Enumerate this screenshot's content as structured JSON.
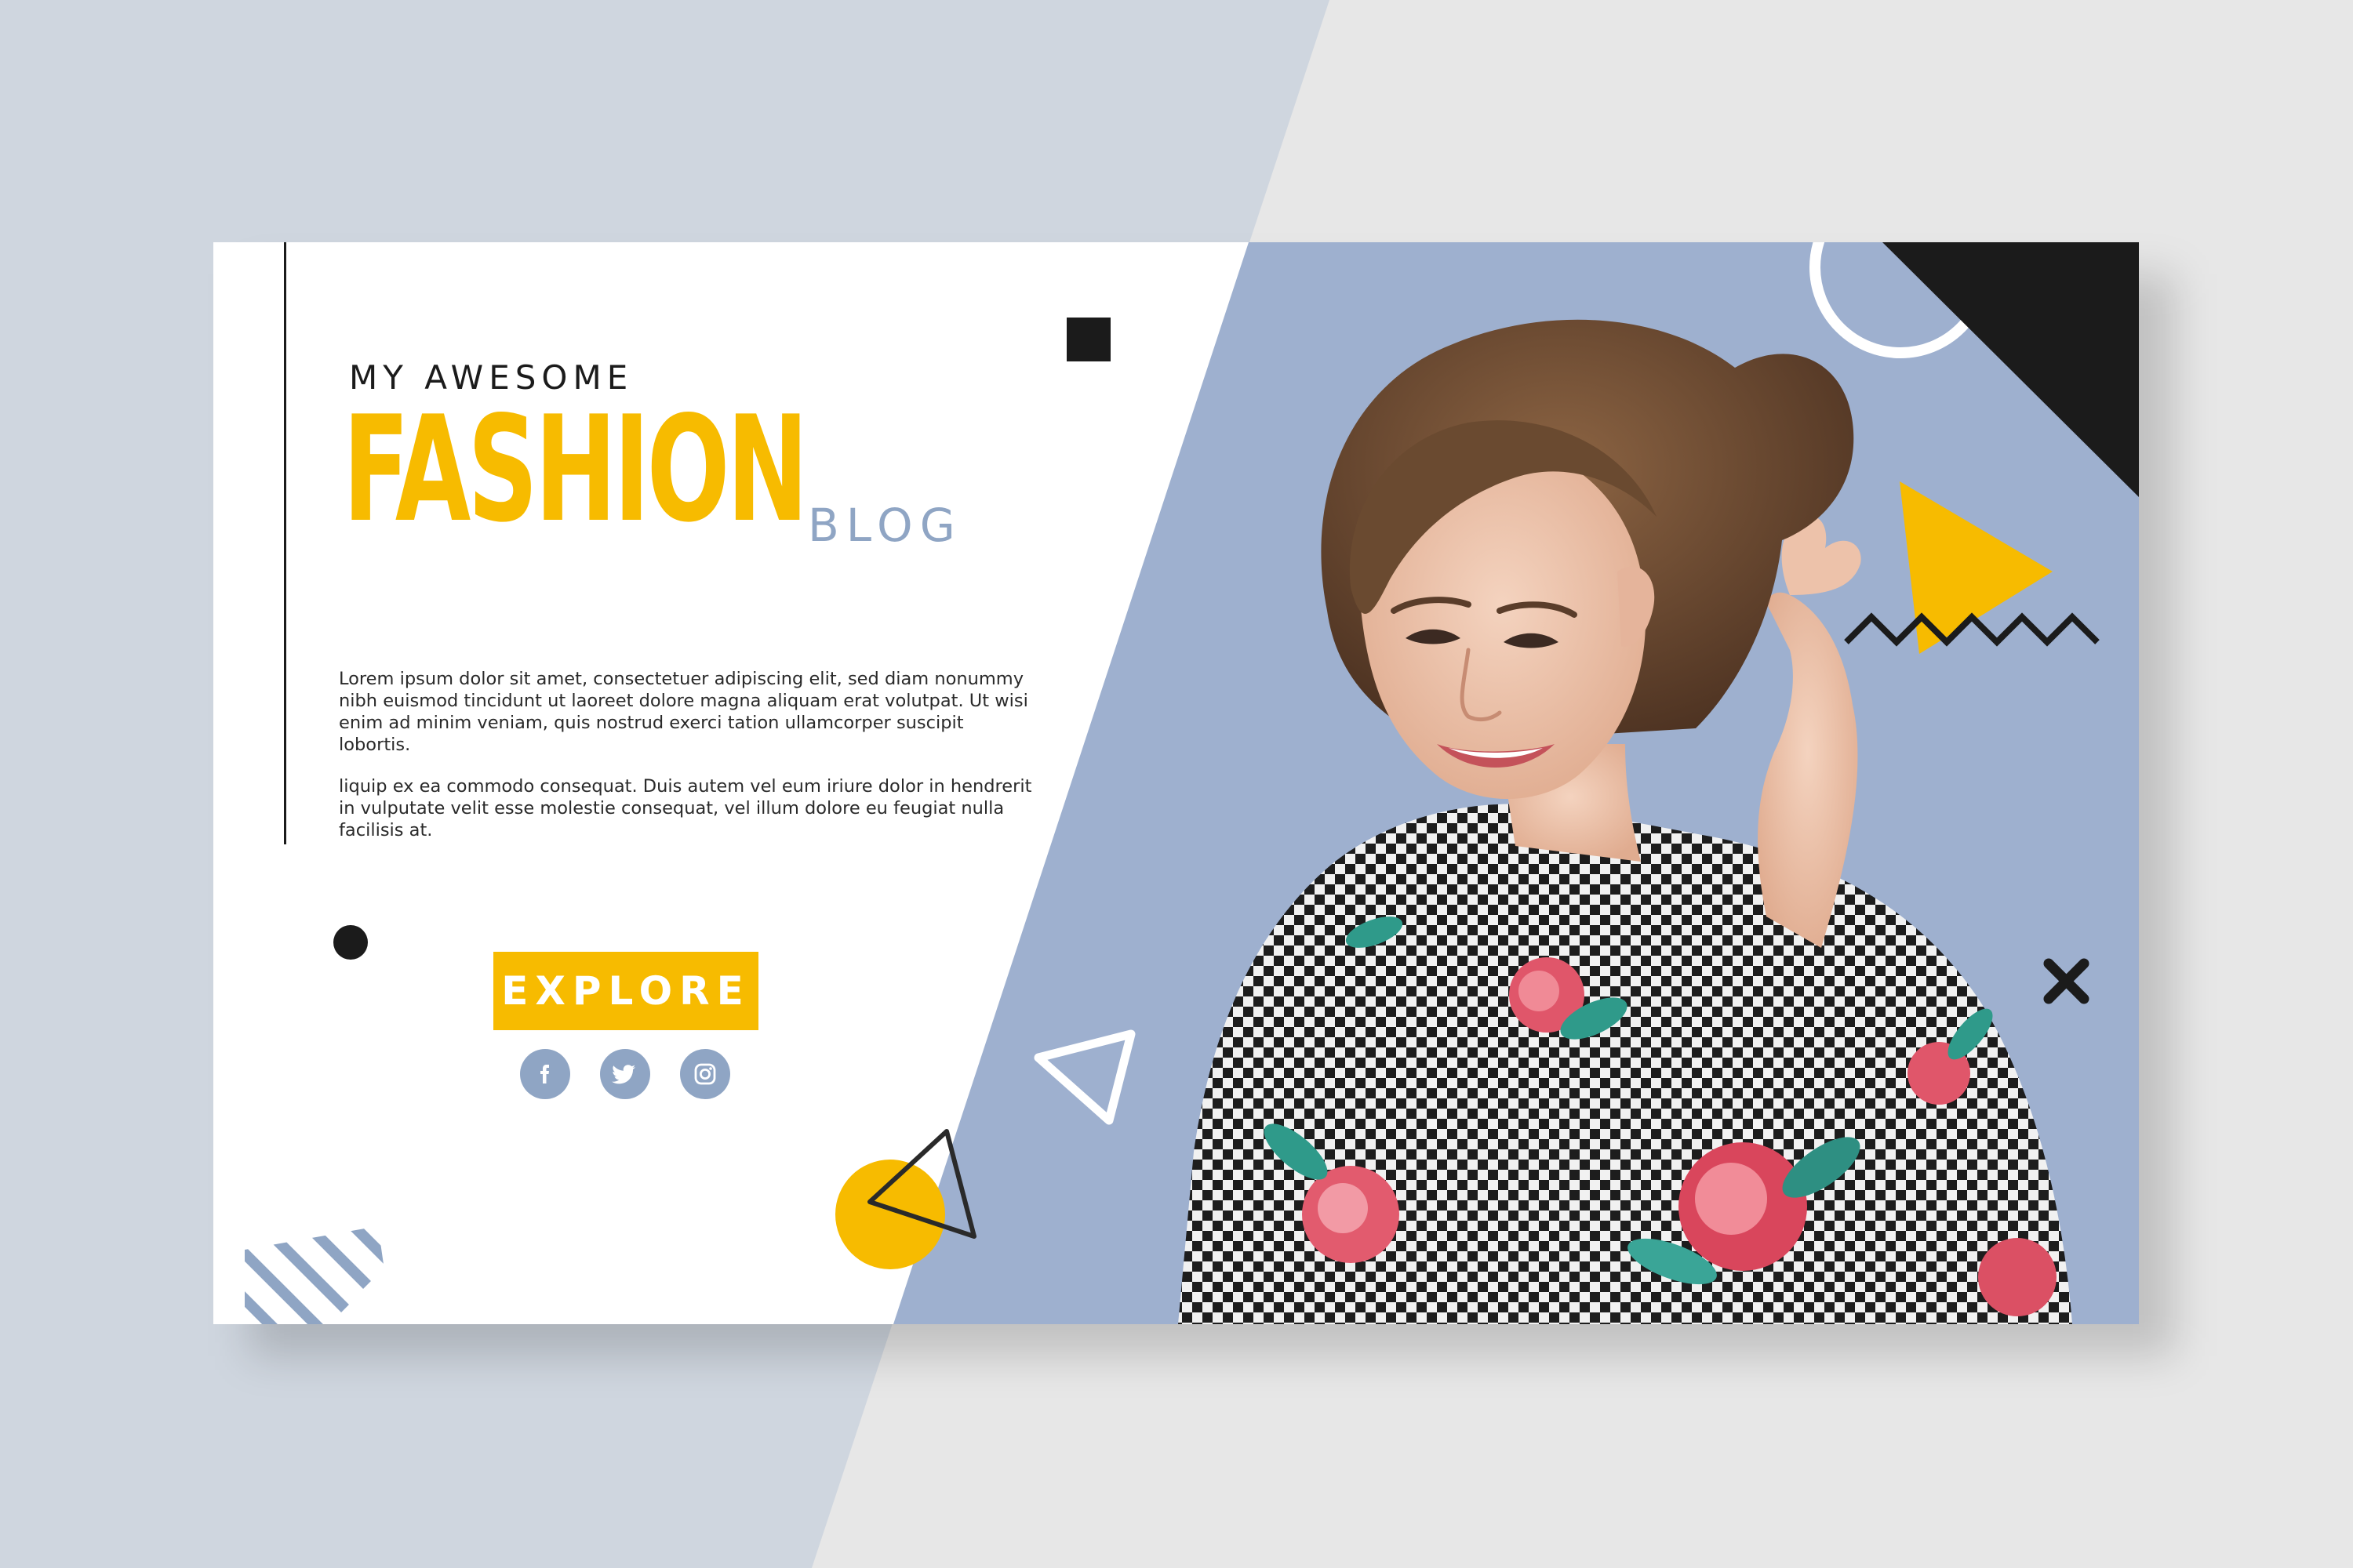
{
  "banner": {
    "kicker": "MY AWESOME",
    "title": "FASHION",
    "subtitle": "BLOG",
    "paragraph_1": "Lorem ipsum dolor sit amet, consectetuer adipiscing elit, sed diam nonummy nibh euismod tincidunt ut laoreet dolore magna aliquam erat volutpat. Ut wisi enim ad minim veniam, quis nostrud exerci tation ullamcorper suscipit lobortis.",
    "paragraph_2": "liquip ex ea commodo consequat. Duis autem vel eum iriure dolor in hendrerit in vulputate velit esse molestie consequat, vel illum dolore eu feugiat nulla facilisis at.",
    "cta_label": "EXPLORE"
  },
  "social_icons": [
    "facebook-icon",
    "twitter-icon",
    "instagram-icon"
  ],
  "colors": {
    "accent_yellow": "#f7bb00",
    "slate_blue": "#8fa5c4",
    "photo_background": "#9eb0cf",
    "dark": "#1b1b1b"
  }
}
